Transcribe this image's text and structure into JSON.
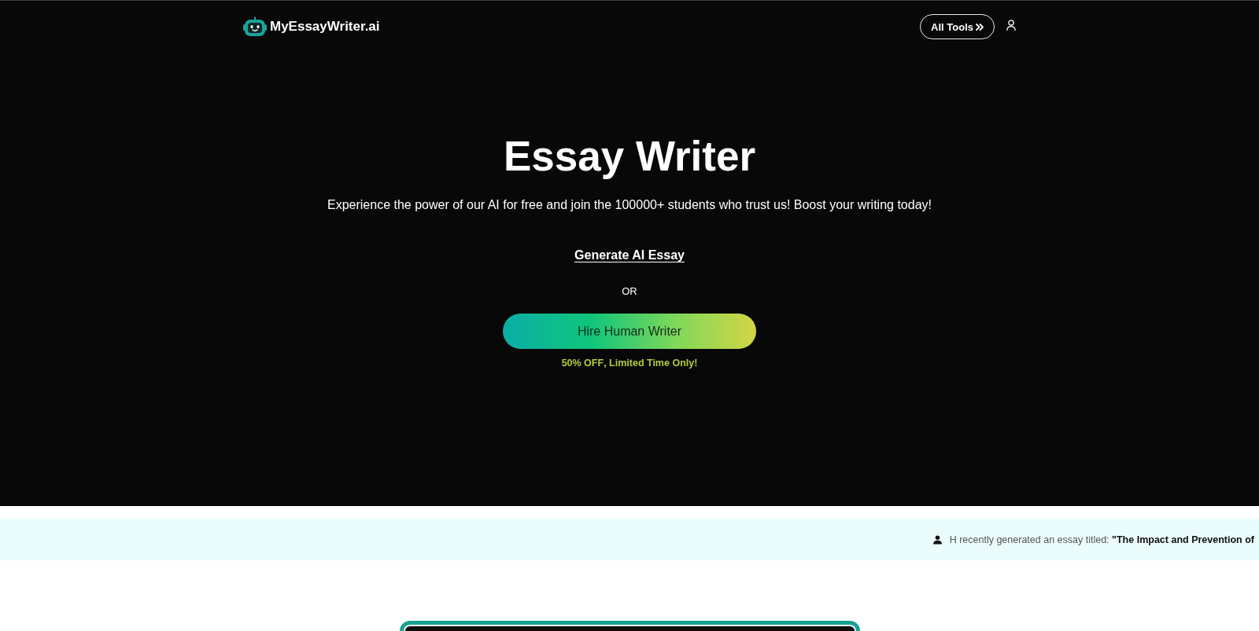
{
  "header": {
    "logo_text": "MyEssayWriter.ai",
    "all_tools_button": "All Tools"
  },
  "hero": {
    "title": "Essay Writer",
    "subtitle": "Experience the power of our AI for free and join the 100000+ students who trust us! Boost your writing today!",
    "primary_link": "Generate AI Essay",
    "separator": "OR",
    "button": "Hire Human Writer",
    "offer": "**50% OFF**, Limited Time Only!"
  },
  "ticker": {
    "items": [
      {
        "text": "H recently generated an essay titled: **\"The Impact and Prevention of**"
      }
    ]
  }
}
